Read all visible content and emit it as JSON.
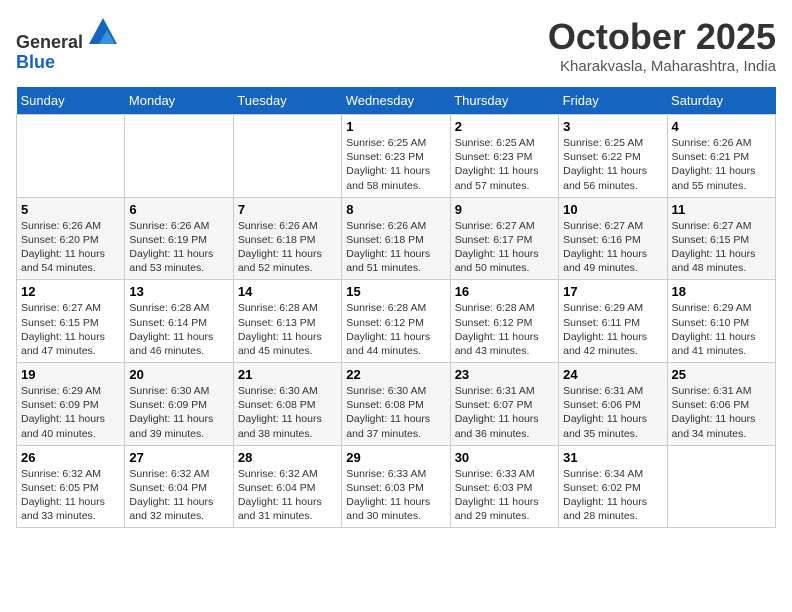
{
  "header": {
    "logo_line1": "General",
    "logo_line2": "Blue",
    "month": "October 2025",
    "location": "Kharakvasla, Maharashtra, India"
  },
  "weekdays": [
    "Sunday",
    "Monday",
    "Tuesday",
    "Wednesday",
    "Thursday",
    "Friday",
    "Saturday"
  ],
  "weeks": [
    [
      {
        "day": "",
        "info": ""
      },
      {
        "day": "",
        "info": ""
      },
      {
        "day": "",
        "info": ""
      },
      {
        "day": "1",
        "info": "Sunrise: 6:25 AM\nSunset: 6:23 PM\nDaylight: 11 hours\nand 58 minutes."
      },
      {
        "day": "2",
        "info": "Sunrise: 6:25 AM\nSunset: 6:23 PM\nDaylight: 11 hours\nand 57 minutes."
      },
      {
        "day": "3",
        "info": "Sunrise: 6:25 AM\nSunset: 6:22 PM\nDaylight: 11 hours\nand 56 minutes."
      },
      {
        "day": "4",
        "info": "Sunrise: 6:26 AM\nSunset: 6:21 PM\nDaylight: 11 hours\nand 55 minutes."
      }
    ],
    [
      {
        "day": "5",
        "info": "Sunrise: 6:26 AM\nSunset: 6:20 PM\nDaylight: 11 hours\nand 54 minutes."
      },
      {
        "day": "6",
        "info": "Sunrise: 6:26 AM\nSunset: 6:19 PM\nDaylight: 11 hours\nand 53 minutes."
      },
      {
        "day": "7",
        "info": "Sunrise: 6:26 AM\nSunset: 6:18 PM\nDaylight: 11 hours\nand 52 minutes."
      },
      {
        "day": "8",
        "info": "Sunrise: 6:26 AM\nSunset: 6:18 PM\nDaylight: 11 hours\nand 51 minutes."
      },
      {
        "day": "9",
        "info": "Sunrise: 6:27 AM\nSunset: 6:17 PM\nDaylight: 11 hours\nand 50 minutes."
      },
      {
        "day": "10",
        "info": "Sunrise: 6:27 AM\nSunset: 6:16 PM\nDaylight: 11 hours\nand 49 minutes."
      },
      {
        "day": "11",
        "info": "Sunrise: 6:27 AM\nSunset: 6:15 PM\nDaylight: 11 hours\nand 48 minutes."
      }
    ],
    [
      {
        "day": "12",
        "info": "Sunrise: 6:27 AM\nSunset: 6:15 PM\nDaylight: 11 hours\nand 47 minutes."
      },
      {
        "day": "13",
        "info": "Sunrise: 6:28 AM\nSunset: 6:14 PM\nDaylight: 11 hours\nand 46 minutes."
      },
      {
        "day": "14",
        "info": "Sunrise: 6:28 AM\nSunset: 6:13 PM\nDaylight: 11 hours\nand 45 minutes."
      },
      {
        "day": "15",
        "info": "Sunrise: 6:28 AM\nSunset: 6:12 PM\nDaylight: 11 hours\nand 44 minutes."
      },
      {
        "day": "16",
        "info": "Sunrise: 6:28 AM\nSunset: 6:12 PM\nDaylight: 11 hours\nand 43 minutes."
      },
      {
        "day": "17",
        "info": "Sunrise: 6:29 AM\nSunset: 6:11 PM\nDaylight: 11 hours\nand 42 minutes."
      },
      {
        "day": "18",
        "info": "Sunrise: 6:29 AM\nSunset: 6:10 PM\nDaylight: 11 hours\nand 41 minutes."
      }
    ],
    [
      {
        "day": "19",
        "info": "Sunrise: 6:29 AM\nSunset: 6:09 PM\nDaylight: 11 hours\nand 40 minutes."
      },
      {
        "day": "20",
        "info": "Sunrise: 6:30 AM\nSunset: 6:09 PM\nDaylight: 11 hours\nand 39 minutes."
      },
      {
        "day": "21",
        "info": "Sunrise: 6:30 AM\nSunset: 6:08 PM\nDaylight: 11 hours\nand 38 minutes."
      },
      {
        "day": "22",
        "info": "Sunrise: 6:30 AM\nSunset: 6:08 PM\nDaylight: 11 hours\nand 37 minutes."
      },
      {
        "day": "23",
        "info": "Sunrise: 6:31 AM\nSunset: 6:07 PM\nDaylight: 11 hours\nand 36 minutes."
      },
      {
        "day": "24",
        "info": "Sunrise: 6:31 AM\nSunset: 6:06 PM\nDaylight: 11 hours\nand 35 minutes."
      },
      {
        "day": "25",
        "info": "Sunrise: 6:31 AM\nSunset: 6:06 PM\nDaylight: 11 hours\nand 34 minutes."
      }
    ],
    [
      {
        "day": "26",
        "info": "Sunrise: 6:32 AM\nSunset: 6:05 PM\nDaylight: 11 hours\nand 33 minutes."
      },
      {
        "day": "27",
        "info": "Sunrise: 6:32 AM\nSunset: 6:04 PM\nDaylight: 11 hours\nand 32 minutes."
      },
      {
        "day": "28",
        "info": "Sunrise: 6:32 AM\nSunset: 6:04 PM\nDaylight: 11 hours\nand 31 minutes."
      },
      {
        "day": "29",
        "info": "Sunrise: 6:33 AM\nSunset: 6:03 PM\nDaylight: 11 hours\nand 30 minutes."
      },
      {
        "day": "30",
        "info": "Sunrise: 6:33 AM\nSunset: 6:03 PM\nDaylight: 11 hours\nand 29 minutes."
      },
      {
        "day": "31",
        "info": "Sunrise: 6:34 AM\nSunset: 6:02 PM\nDaylight: 11 hours\nand 28 minutes."
      },
      {
        "day": "",
        "info": ""
      }
    ]
  ]
}
